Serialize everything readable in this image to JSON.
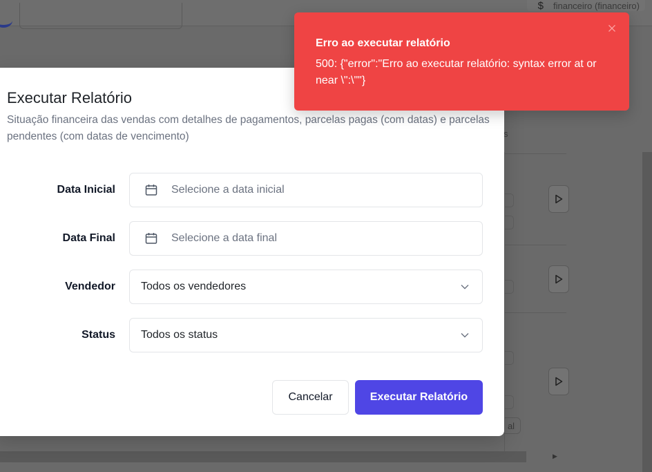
{
  "header": {
    "currency_symbol": "$",
    "user_label": "financeiro (financeiro)"
  },
  "background": {
    "column_fragment": "s",
    "badge_fragment": "al"
  },
  "modal": {
    "title": "Executar Relatório",
    "description": "Situação financeira das vendas com detalhes de pagamentos, parcelas pagas (com datas) e parcelas pendentes (com datas de vencimento)",
    "fields": {
      "start_date": {
        "label": "Data Inicial",
        "placeholder": "Selecione a data inicial",
        "icon": "calendar-icon"
      },
      "end_date": {
        "label": "Data Final",
        "placeholder": "Selecione a data final",
        "icon": "calendar-icon"
      },
      "seller": {
        "label": "Vendedor",
        "value": "Todos os vendedores",
        "icon": "chevron-down-icon"
      },
      "status": {
        "label": "Status",
        "value": "Todos os status",
        "icon": "chevron-down-icon"
      }
    },
    "buttons": {
      "cancel": "Cancelar",
      "run": "Executar Relatório"
    }
  },
  "toast": {
    "title": "Erro ao executar relatório",
    "message": "500: {\"error\":\"Erro ao executar relatório: syntax error at or near \\\":\\\"\"}",
    "close_icon": "close-icon"
  },
  "colors": {
    "primary": "#4f46e5",
    "error": "#ef4444",
    "overlay": "#6b6b6b"
  }
}
